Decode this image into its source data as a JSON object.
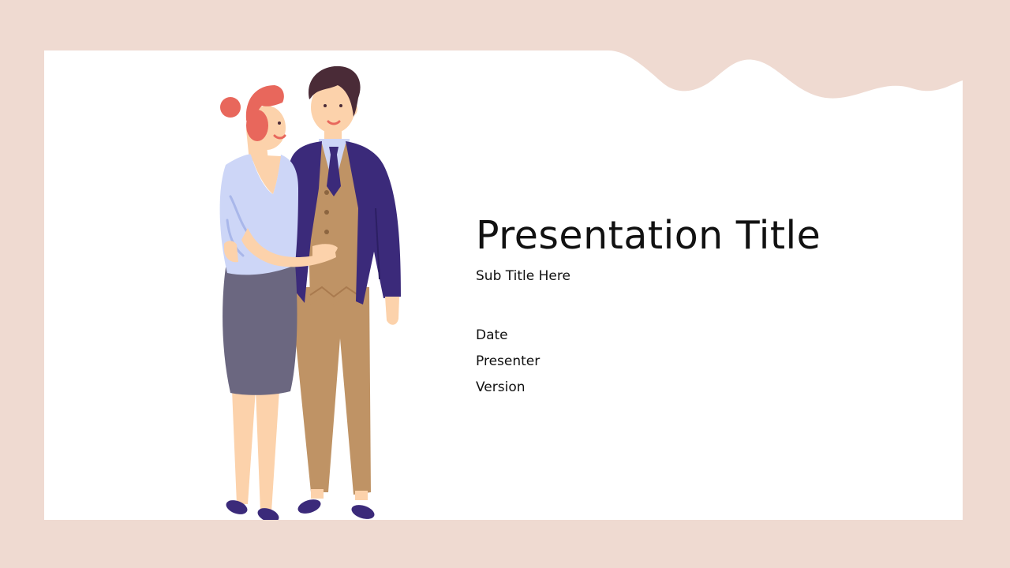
{
  "slide": {
    "title": "Presentation Title",
    "subtitle": "Sub Title Here",
    "meta": {
      "date": "Date",
      "presenter": "Presenter",
      "version": "Version"
    }
  },
  "colors": {
    "frame": "#efdad1",
    "card": "#ffffff",
    "text": "#111111",
    "hair_woman": "#e8675c",
    "blouse": "#cdd6f7",
    "skirt": "#6b6780",
    "skin": "#fcd2ab",
    "hair_man": "#4a2b37",
    "jacket": "#3b2a7a",
    "vest_pants": "#bf9365",
    "shoes": "#3b2a7a"
  },
  "illustration": {
    "subject": "couple-standing"
  }
}
